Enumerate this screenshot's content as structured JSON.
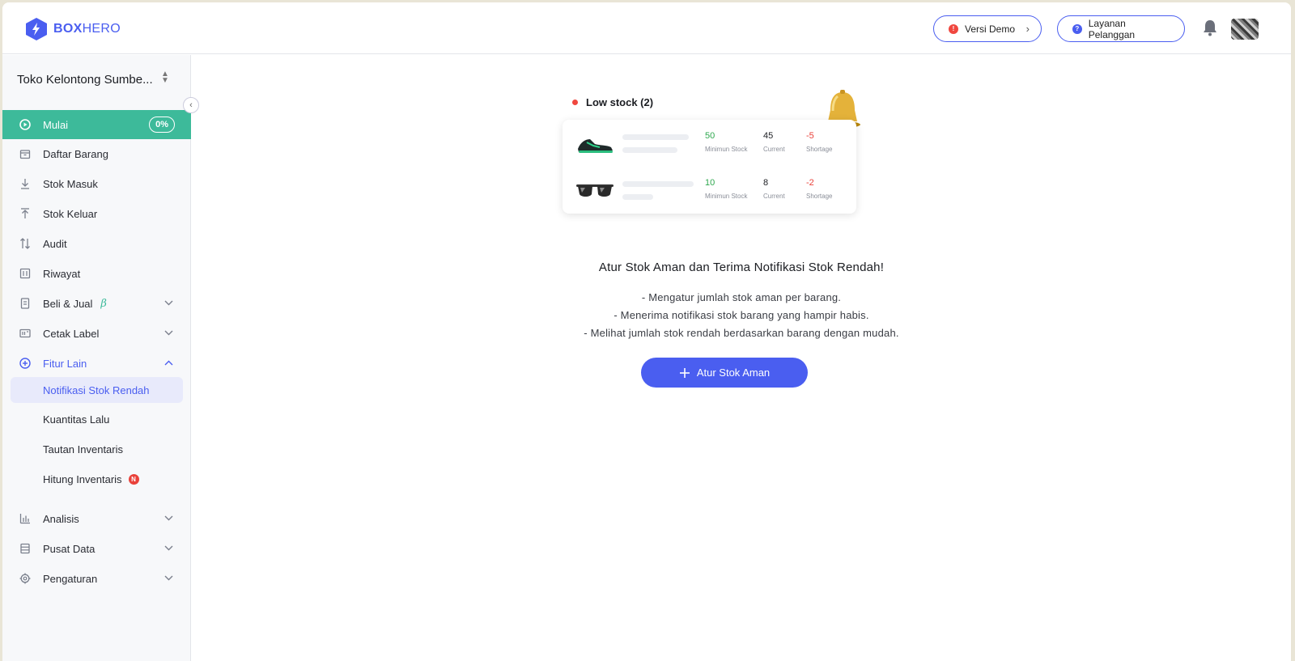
{
  "header": {
    "logo_text_bold": "BOX",
    "logo_text_light": "HERO",
    "demo_label": "Versi Demo",
    "demo_icon": "!",
    "support_label": "Layanan Pelanggan",
    "support_icon": "?"
  },
  "sidebar": {
    "store_name": "Toko Kelontong Sumbe...",
    "items": [
      {
        "label": "Mulai",
        "badge": "0%"
      },
      {
        "label": "Daftar Barang"
      },
      {
        "label": "Stok Masuk"
      },
      {
        "label": "Stok Keluar"
      },
      {
        "label": "Audit"
      },
      {
        "label": "Riwayat"
      },
      {
        "label": "Beli & Jual",
        "tag": "β"
      },
      {
        "label": "Cetak Label"
      },
      {
        "label": "Fitur Lain"
      },
      {
        "label": "Analisis"
      },
      {
        "label": "Pusat Data"
      },
      {
        "label": "Pengaturan"
      }
    ],
    "sub_items": [
      {
        "label": "Notifikasi Stok Rendah"
      },
      {
        "label": "Kuantitas Lalu"
      },
      {
        "label": "Tautan Inventaris"
      },
      {
        "label": "Hitung Inventaris",
        "badge": "N"
      }
    ]
  },
  "main": {
    "illustration": {
      "title": "Low stock (2)",
      "rows": [
        {
          "min": "50",
          "min_label": "Minimun Stock",
          "current": "45",
          "current_label": "Current",
          "shortage": "-5",
          "shortage_label": "Shortage"
        },
        {
          "min": "10",
          "min_label": "Minimun Stock",
          "current": "8",
          "current_label": "Current",
          "shortage": "-2",
          "shortage_label": "Shortage"
        }
      ]
    },
    "headline": "Atur Stok Aman dan Terima Notifikasi Stok Rendah!",
    "bullets": [
      "- Mengatur jumlah stok aman per barang.",
      "- Menerima notifikasi stok barang yang hampir habis.",
      "- Melihat jumlah stok rendah berdasarkan barang dengan mudah."
    ],
    "cta_label": "Atur Stok Aman"
  },
  "colors": {
    "brand": "#4a5ef0",
    "accent_green": "#3dba9a",
    "alert_red": "#f0473f"
  }
}
